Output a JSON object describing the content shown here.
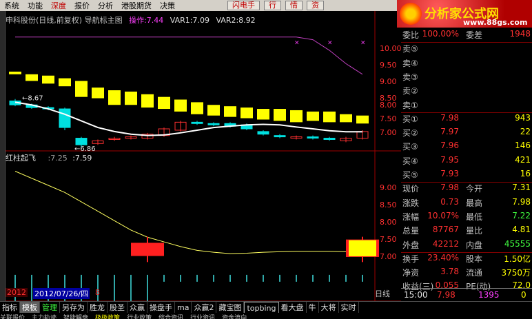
{
  "menubar": {
    "items": [
      "系统",
      "功能",
      "深度",
      "报价",
      "分析",
      "港股期货",
      "决策"
    ],
    "buttons": [
      "闪电手",
      "行",
      "情",
      "资"
    ]
  },
  "logo": {
    "title": "分析家公式网",
    "url": "www.88gs.com"
  },
  "chart": {
    "title_prefix": "申科股份(日线,前复权) 导航标主图",
    "op_label": "操作:7.44",
    "var1": "VAR1:7.09",
    "var2": "VAR2:8.92",
    "high_label": "8.67",
    "low_label": "6.86",
    "indicator_name": "红柱起飞",
    "indicator_v1": ":7.25",
    "indicator_v2": ":7.59",
    "main_axis": [
      "10.00",
      "9.50",
      "9.00",
      "8.50",
      "8.00",
      "7.50",
      "7.00"
    ],
    "sub_axis": [
      "9.00",
      "8.50",
      "8.00",
      "7.50",
      "7.00"
    ],
    "date_a": "2012",
    "date_b": "2012/07/26/四",
    "date_c": "8",
    "period": "日线"
  },
  "chart_data": {
    "type": "line",
    "main": {
      "candles": [
        {
          "o": 9.7,
          "c": 9.6,
          "h": 9.75,
          "l": 9.6
        },
        {
          "o": 9.6,
          "c": 9.35,
          "h": 9.65,
          "l": 9.3
        },
        {
          "o": 9.55,
          "c": 9.25,
          "h": 9.6,
          "l": 9.2
        },
        {
          "o": 9.45,
          "c": 9.15,
          "h": 9.5,
          "l": 9.1
        },
        {
          "o": 9.35,
          "c": 8.75,
          "h": 9.4,
          "l": 8.7
        },
        {
          "o": 9.1,
          "c": 8.7,
          "h": 9.15,
          "l": 8.65
        },
        {
          "o": 9.0,
          "c": 8.45,
          "h": 9.05,
          "l": 8.4
        },
        {
          "o": 8.95,
          "c": 8.45,
          "h": 8.95,
          "l": 8.4
        },
        {
          "o": 8.85,
          "c": 8.35,
          "h": 8.9,
          "l": 8.3
        },
        {
          "o": 8.75,
          "c": 8.3,
          "h": 8.8,
          "l": 8.25
        },
        {
          "o": 8.65,
          "c": 8.2,
          "h": 8.7,
          "l": 8.15
        },
        {
          "o": 8.55,
          "c": 8.1,
          "h": 8.6,
          "l": 8.05
        },
        {
          "o": 8.45,
          "c": 8.05,
          "h": 8.5,
          "l": 8.0
        },
        {
          "o": 8.4,
          "c": 8.0,
          "h": 8.45,
          "l": 7.95
        },
        {
          "o": 8.35,
          "c": 7.95,
          "h": 8.4,
          "l": 7.9
        },
        {
          "o": 8.3,
          "c": 7.9,
          "h": 8.35,
          "l": 7.85
        },
        {
          "o": 8.3,
          "c": 7.85,
          "h": 8.3,
          "l": 7.8
        },
        {
          "o": 8.25,
          "c": 7.8,
          "h": 8.3,
          "l": 7.75
        },
        {
          "o": 8.2,
          "c": 7.85,
          "h": 8.25,
          "l": 7.8
        },
        {
          "o": 8.2,
          "c": 7.8,
          "h": 8.25,
          "l": 7.75
        },
        {
          "o": 8.1,
          "c": 7.8,
          "h": 8.15,
          "l": 7.75
        },
        {
          "o": 8.05,
          "c": 7.75,
          "h": 8.1,
          "l": 7.7
        }
      ],
      "price_bars": [
        {
          "o": 8.6,
          "c": 8.45,
          "h": 8.67,
          "l": 8.4,
          "up": false
        },
        {
          "o": 8.45,
          "c": 8.35,
          "h": 8.5,
          "l": 8.3,
          "up": false
        },
        {
          "o": 8.35,
          "c": 8.3,
          "h": 8.4,
          "l": 8.25,
          "up": false
        },
        {
          "o": 8.3,
          "c": 7.6,
          "h": 8.35,
          "l": 7.5,
          "up": false
        },
        {
          "o": 7.2,
          "c": 6.95,
          "h": 7.25,
          "l": 6.86,
          "up": false
        },
        {
          "o": 7.0,
          "c": 7.1,
          "h": 7.15,
          "l": 6.95,
          "up": true
        },
        {
          "o": 7.15,
          "c": 7.2,
          "h": 7.25,
          "l": 7.1,
          "up": true
        },
        {
          "o": 7.2,
          "c": 7.25,
          "h": 7.3,
          "l": 7.15,
          "up": true
        },
        {
          "o": 7.2,
          "c": 7.35,
          "h": 7.4,
          "l": 7.15,
          "up": true
        },
        {
          "o": 7.3,
          "c": 7.55,
          "h": 7.6,
          "l": 7.25,
          "up": true
        },
        {
          "o": 7.5,
          "c": 7.8,
          "h": 7.85,
          "l": 7.45,
          "up": true
        },
        {
          "o": 7.8,
          "c": 7.75,
          "h": 7.85,
          "l": 7.7,
          "up": false
        },
        {
          "o": 7.75,
          "c": 7.7,
          "h": 7.8,
          "l": 7.65,
          "up": false
        },
        {
          "o": 7.75,
          "c": 7.65,
          "h": 7.8,
          "l": 7.6,
          "up": false
        },
        {
          "o": 7.7,
          "c": 7.55,
          "h": 7.75,
          "l": 7.5,
          "up": false
        },
        {
          "o": 7.45,
          "c": 7.35,
          "h": 7.5,
          "l": 7.3,
          "up": false
        },
        {
          "o": 7.3,
          "c": 7.25,
          "h": 7.35,
          "l": 7.2,
          "up": false
        },
        {
          "o": 7.2,
          "c": 7.25,
          "h": 7.3,
          "l": 7.15,
          "up": true
        },
        {
          "o": 7.25,
          "c": 7.2,
          "h": 7.3,
          "l": 7.15,
          "up": false
        },
        {
          "o": 7.2,
          "c": 7.15,
          "h": 7.25,
          "l": 7.1,
          "up": false
        },
        {
          "o": 7.1,
          "c": 7.2,
          "h": 7.25,
          "l": 7.05,
          "up": true
        },
        {
          "o": 7.2,
          "c": 7.45,
          "h": 7.5,
          "l": 7.15,
          "up": true
        }
      ],
      "ma_line": [
        8.55,
        8.45,
        8.3,
        8.1,
        7.85,
        7.6,
        7.45,
        7.35,
        7.3,
        7.32,
        7.4,
        7.5,
        7.6,
        7.65,
        7.7,
        7.72,
        7.7,
        7.62,
        7.55,
        7.48,
        7.44,
        7.44
      ],
      "purple_line": [
        11.0,
        11.0,
        11.0,
        11.0,
        11.0,
        11.0,
        11.0,
        11.0,
        11.0,
        11.0,
        11.0,
        11.0,
        11.0,
        11.0,
        11.0,
        11.0,
        11.0,
        11.0,
        10.9,
        10.5,
        10.0,
        9.6
      ],
      "ylim": [
        6.8,
        11.2
      ]
    },
    "sub": {
      "line": [
        9.3,
        9.15,
        9.0,
        8.85,
        8.65,
        8.45,
        8.25,
        8.05,
        7.9,
        7.8,
        7.7,
        7.62,
        7.58,
        7.55,
        7.56,
        7.58,
        7.59,
        7.6,
        7.6,
        7.6,
        7.59,
        7.59
      ],
      "red_boxes": [
        {
          "index": 8,
          "o": 7.5,
          "c": 7.78,
          "h": 7.85,
          "l": 7.43
        },
        {
          "index": 21,
          "o": 7.48,
          "c": 7.85,
          "h": 7.85,
          "l": 7.43
        }
      ],
      "ylim": [
        6.85,
        9.6
      ]
    }
  },
  "quote": {
    "rows": [
      {
        "l": "委比",
        "v1": "100.00%",
        "l2": "委差",
        "v2": "1948"
      },
      {
        "l": "卖⑤",
        "v1": "",
        "l2": "",
        "v2": ""
      },
      {
        "l": "卖④",
        "v1": "",
        "l2": "",
        "v2": ""
      },
      {
        "l": "卖③",
        "v1": "",
        "l2": "",
        "v2": ""
      },
      {
        "l": "卖②",
        "v1": "",
        "l2": "",
        "v2": ""
      },
      {
        "l": "卖①",
        "v1": "",
        "l2": "",
        "v2": ""
      },
      {
        "l": "买①",
        "v1": "7.98",
        "l2": "",
        "v2": "943"
      },
      {
        "l": "买②",
        "v1": "7.97",
        "l2": "",
        "v2": "22"
      },
      {
        "l": "买③",
        "v1": "7.96",
        "l2": "",
        "v2": "146"
      },
      {
        "l": "买④",
        "v1": "7.95",
        "l2": "",
        "v2": "421"
      },
      {
        "l": "买⑤",
        "v1": "7.93",
        "l2": "",
        "v2": "16"
      },
      {
        "l": "现价",
        "v1": "7.98",
        "l2": "今开",
        "v2": "7.31"
      },
      {
        "l": "涨跌",
        "v1": "0.73",
        "l2": "最高",
        "v2": "7.98"
      },
      {
        "l": "涨幅",
        "v1": "10.07%",
        "l2": "最低",
        "v2": "7.22"
      },
      {
        "l": "总量",
        "v1": "87767",
        "l2": "量比",
        "v2": "4.81"
      },
      {
        "l": "外盘",
        "v1": "42212",
        "l2": "内盘",
        "v2": "45555"
      },
      {
        "l": "换手",
        "v1": "23.40%",
        "l2": "股本",
        "v2": "1.50亿"
      },
      {
        "l": "净资",
        "v1": "3.78",
        "l2": "流通",
        "v2": "3750万"
      },
      {
        "l": "收益(三)",
        "v1": "0.055",
        "l2": "PE(动)",
        "v2": "72.0"
      }
    ],
    "foot_time": "15:00",
    "foot_price": "7.98",
    "foot_vol": "1395",
    "foot_flag": "0"
  },
  "bottom_tabs": [
    "指标",
    "模板",
    "管理",
    "另存为",
    "胜龙",
    "股圣",
    "众赢",
    "操盘手",
    "ma",
    "众赢2",
    "藏宝图",
    "topbing",
    "看大盘",
    "牛",
    "大将",
    "实时"
  ],
  "bottom_tabs2": [
    "关联报价",
    "主力轨迹",
    "智能解盘",
    "极极政策",
    "行业政策",
    "综合资讯",
    "行业资讯",
    "资金流向"
  ],
  "colors": {
    "bg": "#000000",
    "yellow": "#ffff00",
    "cyan": "#00e0e0",
    "red": "#ff2020",
    "magenta": "#e040e0"
  }
}
